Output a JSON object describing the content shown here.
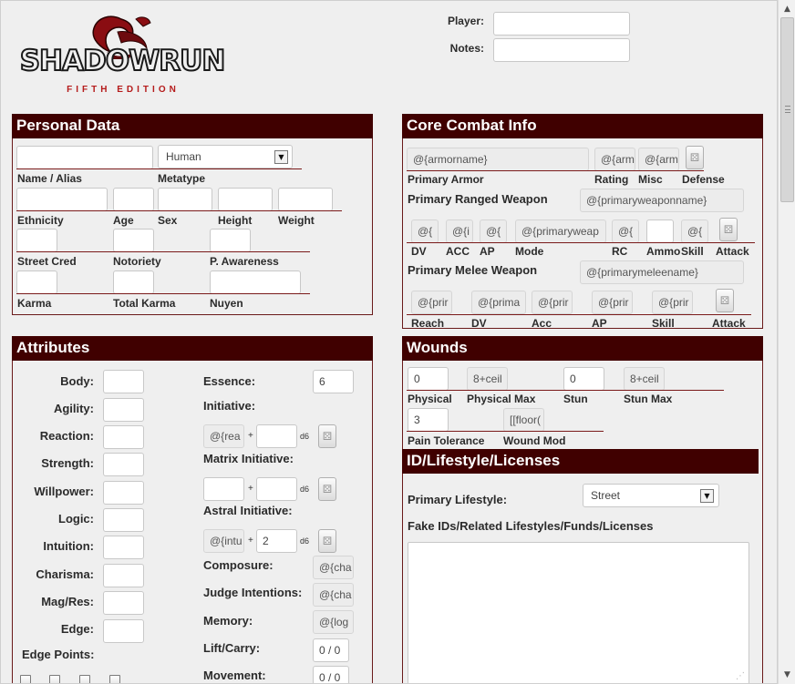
{
  "logo": {
    "name": "SHADOWRUN",
    "edition": "FIFTH EDITION",
    "colors": {
      "dragon": "#8a0d12",
      "title": "#f0f0f0",
      "outline": "#1a1a1a",
      "edition": "#b51b1b"
    }
  },
  "header": {
    "player_label": "Player:",
    "notes_label": "Notes:",
    "player_value": "",
    "notes_value": ""
  },
  "colors": {
    "section_header": "#400000",
    "rule": "#7a1a1a",
    "background": "#efefef"
  },
  "personal": {
    "title": "Personal Data",
    "name_label": "Name / Alias",
    "metatype_label": "Metatype",
    "metatype_value": "Human",
    "ethnicity_label": "Ethnicity",
    "age_label": "Age",
    "sex_label": "Sex",
    "height_label": "Height",
    "weight_label": "Weight",
    "street_cred_label": "Street Cred",
    "notoriety_label": "Notoriety",
    "p_awareness_label": "P. Awareness",
    "karma_label": "Karma",
    "total_karma_label": "Total Karma",
    "nuyen_label": "Nuyen"
  },
  "combat": {
    "title": "Core Combat Info",
    "armor_name": "@{armorname}",
    "armor_rating": "@{arm",
    "armor_misc": "@{arm",
    "primary_armor_label": "Primary Armor",
    "rating_label": "Rating",
    "misc_label": "Misc",
    "defense_label": "Defense",
    "ranged_label": "Primary Ranged Weapon",
    "ranged_name": "@{primaryweaponname}",
    "ranged_dv": "@{",
    "ranged_acc": "@{i",
    "ranged_ap": "@{",
    "ranged_mode": "@{primaryweap",
    "ranged_rc": "@{",
    "ranged_ammo": "",
    "ranged_skill": "@{",
    "dv_label": "DV",
    "acc_label": "ACC",
    "ap_label": "AP",
    "mode_label": "Mode",
    "rc_label": "RC",
    "ammo_label": "Ammo",
    "skill_label": "Skill",
    "attack_label": "Attack",
    "melee_label": "Primary Melee Weapon",
    "melee_name": "@{primarymeleename}",
    "melee_reach": "@{prir",
    "melee_dv": "@{prima",
    "melee_acc": "@{prir",
    "melee_ap": "@{prir",
    "melee_skill": "@{prir",
    "reach_label": "Reach",
    "mdv_label": "DV",
    "macc_label": "Acc",
    "map_label": "AP",
    "mskill_label": "Skill",
    "mattack_label": "Attack"
  },
  "attributes": {
    "title": "Attributes",
    "items": [
      {
        "label": "Body:"
      },
      {
        "label": "Agility:"
      },
      {
        "label": "Reaction:"
      },
      {
        "label": "Strength:"
      },
      {
        "label": "Willpower:"
      },
      {
        "label": "Logic:"
      },
      {
        "label": "Intuition:"
      },
      {
        "label": "Charisma:"
      },
      {
        "label": "Mag/Res:"
      },
      {
        "label": "Edge:"
      }
    ],
    "edge_points_label": "Edge Points:",
    "essence_label": "Essence:",
    "essence_value": "6",
    "initiative_label": "Initiative:",
    "init_base": "@{rea",
    "init_dice": "",
    "matrix_label": "Matrix Initiative:",
    "matrix_base": "",
    "matrix_dice": "",
    "astral_label": "Astral Initiative:",
    "astral_base": "@{intu",
    "astral_dice": "2",
    "plus": "+",
    "d6": "d6",
    "composure_label": "Composure:",
    "composure_value": "@{cha",
    "judge_label": "Judge Intentions:",
    "judge_value": "@{cha",
    "memory_label": "Memory:",
    "memory_value": "@{log",
    "lift_label": "Lift/Carry:",
    "lift_value": "0 / 0",
    "movement_label": "Movement:",
    "movement_value": "0 / 0"
  },
  "wounds": {
    "title": "Wounds",
    "physical": "0",
    "physical_max": "8+ceil",
    "stun": "0",
    "stun_max": "8+ceil",
    "physical_label": "Physical",
    "physical_max_label": "Physical Max",
    "stun_label": "Stun",
    "stun_max_label": "Stun Max",
    "pain_value": "3",
    "wound_mod_value": "[[floor(",
    "pain_label": "Pain Tolerance",
    "wound_mod_label": "Wound Mod"
  },
  "lifestyle": {
    "title": "ID/Lifestyle/Licenses",
    "primary_label": "Primary Lifestyle:",
    "primary_value": "Street",
    "fake_ids_label": "Fake IDs/Related Lifestyles/Funds/Licenses",
    "fake_ids_value": ""
  }
}
